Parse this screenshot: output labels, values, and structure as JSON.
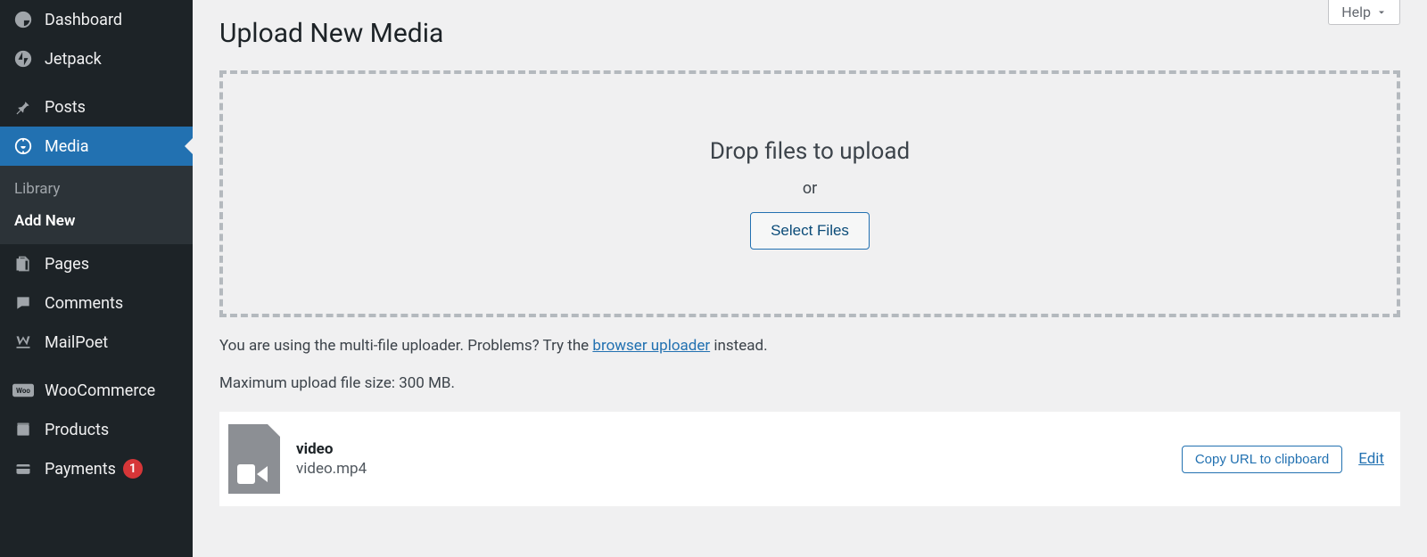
{
  "sidebar": {
    "items": [
      {
        "label": "Dashboard"
      },
      {
        "label": "Jetpack"
      },
      {
        "label": "Posts"
      },
      {
        "label": "Media"
      },
      {
        "label": "Pages"
      },
      {
        "label": "Comments"
      },
      {
        "label": "MailPoet"
      },
      {
        "label": "WooCommerce"
      },
      {
        "label": "Products"
      },
      {
        "label": "Payments",
        "badge": "1"
      }
    ],
    "submenu": [
      {
        "label": "Library"
      },
      {
        "label": "Add New"
      }
    ]
  },
  "header": {
    "help_label": "Help",
    "page_title": "Upload New Media"
  },
  "dropzone": {
    "drop_text": "Drop files to upload",
    "or_text": "or",
    "select_files_label": "Select Files"
  },
  "notes": {
    "prefix": "You are using the multi-file uploader. Problems? Try the ",
    "link_text": "browser uploader",
    "suffix": " instead.",
    "max_size": "Maximum upload file size: 300 MB."
  },
  "uploaded": {
    "title": "video",
    "filename": "video.mp4",
    "copy_label": "Copy URL to clipboard",
    "edit_label": "Edit"
  }
}
